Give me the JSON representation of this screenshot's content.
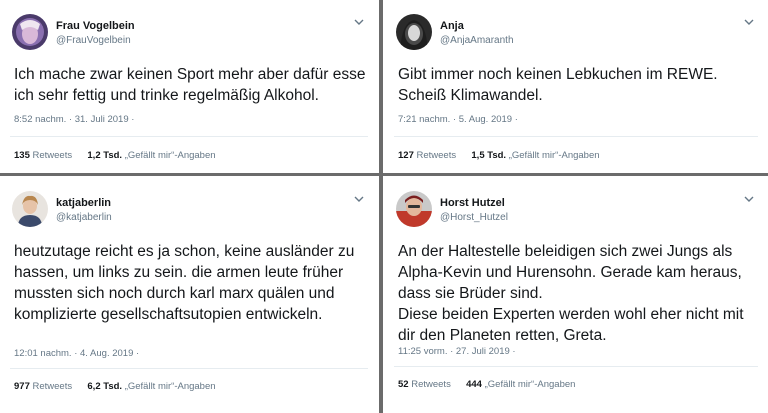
{
  "tweets": [
    {
      "name": "Frau Vogelbein",
      "handle": "@FrauVogelbein",
      "text": "Ich mache zwar keinen Sport mehr aber dafür esse ich sehr fettig und trinke regelmäßig Alkohol.",
      "timestamp": "8:52 nachm. · 31. Juli 2019 ·",
      "retweets_count": "135",
      "retweets_label": "Retweets",
      "likes_count": "1,2 Tsd.",
      "likes_label": "„Gefällt mir“-Angaben"
    },
    {
      "name": "Anja",
      "handle": "@AnjaAmaranth",
      "text": "Gibt immer noch keinen Lebkuchen im REWE. Scheiß Klimawandel.",
      "timestamp": "7:21 nachm. · 5. Aug. 2019 ·",
      "retweets_count": "127",
      "retweets_label": "Retweets",
      "likes_count": "1,5 Tsd.",
      "likes_label": "„Gefällt mir“-Angaben"
    },
    {
      "name": "katjaberlin",
      "handle": "@katjaberlin",
      "text": "heutzutage reicht es ja schon, keine ausländer zu hassen, um links zu sein. die armen leute früher mussten sich noch durch karl marx quälen und komplizierte gesellschaftsutopien entwickeln.",
      "timestamp": "12:01 nachm. · 4. Aug. 2019 ·",
      "retweets_count": "977",
      "retweets_label": "Retweets",
      "likes_count": "6,2 Tsd.",
      "likes_label": "„Gefällt mir“-Angaben"
    },
    {
      "name": "Horst Hutzel",
      "handle": "@Horst_Hutzel",
      "text": "An der Haltestelle beleidigen sich zwei Jungs als Alpha-Kevin und Hurensohn. Gerade kam heraus, dass sie Brüder sind.\nDiese beiden Experten werden wohl eher nicht mit dir den Planeten retten, Greta.",
      "timestamp": "11:25 vorm. · 27. Juli 2019 ·",
      "retweets_count": "52",
      "retweets_label": "Retweets",
      "likes_count": "444",
      "likes_label": "„Gefällt mir“-Angaben"
    }
  ],
  "colors": {
    "text": "#14171a",
    "secondary": "#657786",
    "divider": "#6b6b6b",
    "separator": "#e6ecf0"
  },
  "icons": {
    "menu": "chevron-down-icon"
  }
}
